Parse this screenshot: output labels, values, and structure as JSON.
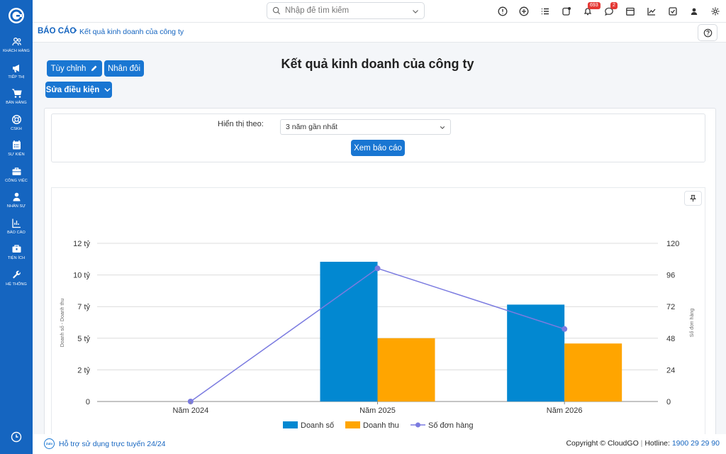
{
  "sidebar": {
    "items": [
      {
        "label": "KHÁCH HÀNG",
        "icon": "users-icon"
      },
      {
        "label": "TIẾP THỊ",
        "icon": "megaphone-icon"
      },
      {
        "label": "BÁN HÀNG",
        "icon": "cart-icon"
      },
      {
        "label": "CSKH",
        "icon": "lifebuoy-icon"
      },
      {
        "label": "SỰ KIỆN",
        "icon": "calendar-icon"
      },
      {
        "label": "CÔNG VIỆC",
        "icon": "briefcase-icon"
      },
      {
        "label": "NHÂN SỰ",
        "icon": "person-icon"
      },
      {
        "label": "BÁO CÁO",
        "icon": "report-icon"
      },
      {
        "label": "TIỆN ÍCH",
        "icon": "toolbox-icon"
      },
      {
        "label": "HỆ THỐNG",
        "icon": "wrench-icon"
      }
    ]
  },
  "topbar": {
    "search_placeholder": "Nhập để tìm kiếm",
    "notification_count": "693",
    "message_count": "2"
  },
  "breadcrumb": {
    "root": "BÁO CÁO",
    "separator": "›",
    "current": "Kết quả kinh doanh của công ty"
  },
  "actions": {
    "customize_label": "Tùy chỉnh",
    "duplicate_label": "Nhân đôi",
    "edit_conditions_label": "Sửa điều kiện"
  },
  "page_title": "Kết quả kinh doanh của công ty",
  "filter": {
    "label": "Hiển thị theo:",
    "selected": "3 năm gần nhất",
    "submit_label": "Xem báo cáo"
  },
  "colors": {
    "primary": "#1976d2",
    "sidebar": "#1565c0",
    "doanh_so": "#0288d1",
    "doanh_thu": "#ffa500",
    "so_don_hang": "#7b7be0"
  },
  "chart_data": {
    "type": "bar",
    "categories": [
      "Năm 2024",
      "Năm 2025",
      "Năm 2026"
    ],
    "y_ticks": [
      "0",
      "2 tỷ",
      "5 tỷ",
      "7 tỷ",
      "10 tỷ",
      "12 tỷ"
    ],
    "y2_ticks": [
      "0",
      "24",
      "48",
      "72",
      "96",
      "120"
    ],
    "ylabel": "Doanh số - Doanh thu",
    "y2label": "Số đơn hàng",
    "ylim": [
      0,
      12
    ],
    "y2lim": [
      0,
      120
    ],
    "series": [
      {
        "name": "Doanh số",
        "type": "bar",
        "axis": "left",
        "values": [
          0,
          10.6,
          7.35
        ]
      },
      {
        "name": "Doanh thu",
        "type": "bar",
        "axis": "left",
        "values": [
          0,
          4.8,
          4.4
        ]
      },
      {
        "name": "Số đơn hàng",
        "type": "line",
        "axis": "right",
        "values": [
          0,
          101,
          55
        ]
      }
    ],
    "legend": "bottom",
    "grid": true
  },
  "footer": {
    "zalo_label": "Zalo",
    "support_text": "Hỗ trợ sử dụng trực tuyến 24/24",
    "copyright": "Copyright © CloudGO",
    "hotline_label": "Hotline:",
    "phone": "1900 29 29 90"
  }
}
